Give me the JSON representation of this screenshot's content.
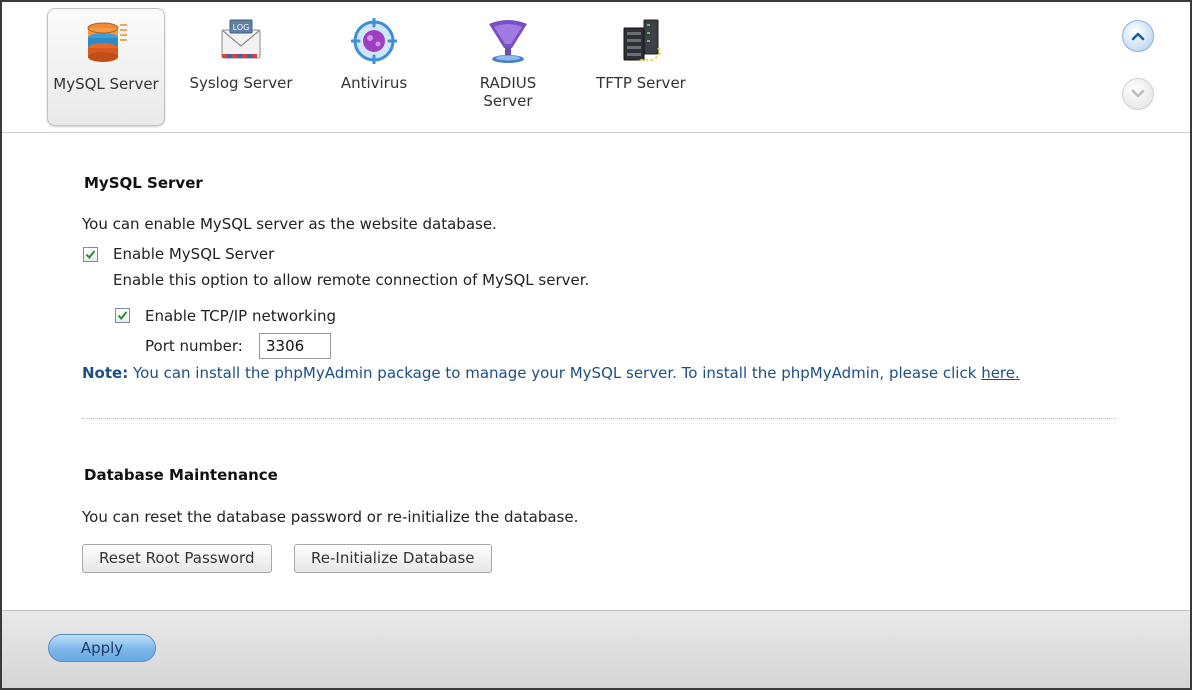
{
  "apps": [
    {
      "label": "MySQL Server",
      "icon": "mysql-database-icon",
      "active": true
    },
    {
      "label": "Syslog Server",
      "icon": "syslog-envelope-icon",
      "active": false
    },
    {
      "label": "Antivirus",
      "icon": "antivirus-icon",
      "active": false
    },
    {
      "label": "RADIUS\nServer",
      "icon": "radius-server-icon",
      "active": false
    },
    {
      "label": "TFTP Server",
      "icon": "tftp-server-icon",
      "active": false
    }
  ],
  "mysql": {
    "title": "MySQL Server",
    "description": "You can enable MySQL server as the website database.",
    "enable_label": "Enable MySQL Server",
    "enable_checked": true,
    "enable_hint": "Enable this option to allow remote connection of MySQL server.",
    "tcp_label": "Enable TCP/IP networking",
    "tcp_checked": true,
    "port_label": "Port number:",
    "port_value": "3306",
    "note_prefix": "Note:",
    "note_text": " You can install the phpMyAdmin package to manage your MySQL server. To install the phpMyAdmin, please click ",
    "note_link": "here."
  },
  "maintenance": {
    "title": "Database Maintenance",
    "description": "You can reset the database password or re-initialize the database.",
    "reset_button": "Reset Root Password",
    "reinit_button": "Re-Initialize Database"
  },
  "footer": {
    "apply_button": "Apply"
  },
  "colors": {
    "note_text": "#1b4f86",
    "apply_blue": "#7db7ea",
    "checkmark_green": "#2e8b2e"
  }
}
